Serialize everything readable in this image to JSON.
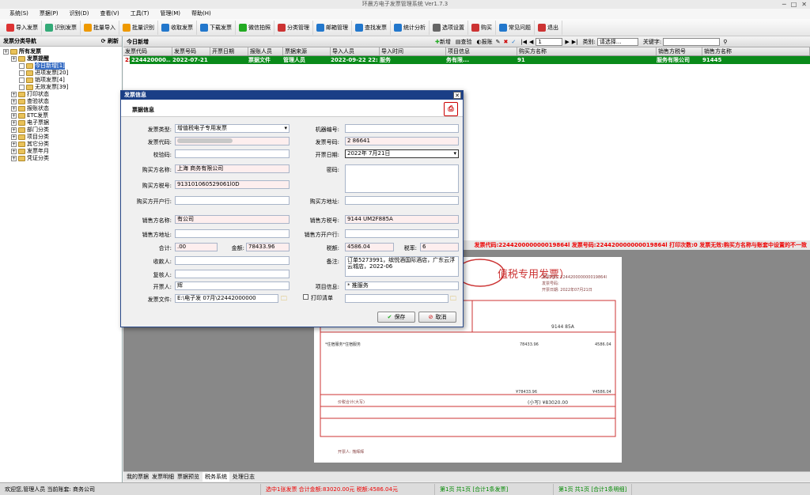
{
  "window": {
    "title": "环晨方电子发票管理系统 Ver1.7.3"
  },
  "menu": [
    "系统(S)",
    "票据(P)",
    "识别(D)",
    "查看(V)",
    "工具(T)",
    "管理(M)",
    "帮助(H)"
  ],
  "toolbar": [
    {
      "label": "导入发票",
      "icon": "import-icon",
      "color": "#d33"
    },
    {
      "label": "识别发票",
      "icon": "recognize-icon",
      "color": "#3a7"
    },
    {
      "label": "批量导入",
      "icon": "batch-import-icon",
      "color": "#e90"
    },
    {
      "label": "批量识别",
      "icon": "batch-recognize-icon",
      "color": "#e90"
    },
    {
      "label": "收取发票",
      "icon": "receive-icon",
      "color": "#27c"
    },
    {
      "label": "下载发票",
      "icon": "download-icon",
      "color": "#27c"
    },
    {
      "label": "微信拍照",
      "icon": "wechat-icon",
      "color": "#2a2"
    },
    {
      "label": "分类管理",
      "icon": "category-icon",
      "color": "#c33"
    },
    {
      "label": "邮箱管理",
      "icon": "mail-icon",
      "color": "#27c"
    },
    {
      "label": "查找发票",
      "icon": "find-icon",
      "color": "#27c"
    },
    {
      "label": "统计分析",
      "icon": "stats-icon",
      "color": "#27c"
    },
    {
      "label": "选项设置",
      "icon": "settings-icon",
      "color": "#666"
    },
    {
      "label": "购买",
      "icon": "buy-icon",
      "color": "#c33"
    },
    {
      "label": "常见问题",
      "icon": "faq-icon",
      "color": "#27c"
    },
    {
      "label": "退出",
      "icon": "exit-icon",
      "color": "#c33"
    }
  ],
  "nav": {
    "title": "发票分类导航",
    "refresh": "刷新",
    "items": [
      {
        "label": "所有发票",
        "level": 0,
        "bold": true
      },
      {
        "label": "发票提醒",
        "level": 1,
        "bold": true
      },
      {
        "label": "今日新增[1]",
        "level": 2,
        "selected": true
      },
      {
        "label": "进项发票[20]",
        "level": 2
      },
      {
        "label": "销项发票[4]",
        "level": 2
      },
      {
        "label": "无效发票[39]",
        "level": 2
      },
      {
        "label": "打印状态",
        "level": 1
      },
      {
        "label": "查验状态",
        "level": 1
      },
      {
        "label": "报账状态",
        "level": 1
      },
      {
        "label": "ETC发票",
        "level": 1
      },
      {
        "label": "电子票据",
        "level": 1
      },
      {
        "label": "部门分类",
        "level": 1
      },
      {
        "label": "项目分类",
        "level": 1
      },
      {
        "label": "其它分类",
        "level": 1
      },
      {
        "label": "发票年月",
        "level": 1
      },
      {
        "label": "凭证分类",
        "level": 1
      }
    ]
  },
  "main": {
    "title": "今日新增",
    "actions": [
      "新增",
      "查验",
      "报账"
    ],
    "page": "1",
    "category_label": "类别:",
    "category_value": "请选择...",
    "keyword_label": "关键字:",
    "columns": [
      "发票代码",
      "发票号码",
      "开票日期",
      "报账人员",
      "票据来源",
      "导入人员",
      "导入时间",
      "项目信息",
      "购买方名称",
      "销售方税号",
      "销售方名称"
    ],
    "row": [
      "224420000000...",
      "224420000...",
      "2022-07-21",
      "",
      "票据文件",
      "管理人员",
      "2022-09-22 22:28:36",
      "服务",
      "务有限...",
      "91",
      "服务有限公司",
      "91445"
    ]
  },
  "warning": "发票代码:224420000000019864l 发票号码:224420000000019864l 打印次数:0 发票无效:购买方名称与账套中设置的不一致",
  "dialog": {
    "title": "发票信息",
    "subtitle": "票据信息",
    "fields": {
      "invoice_type_label": "发票类型:",
      "invoice_type": "增值税电子专用发票",
      "machine_no_label": "机器编号:",
      "machine_no": "",
      "code_label": "发票代码:",
      "code": "",
      "number_label": "发票号码:",
      "number": "2       86641",
      "check_code_label": "校验码:",
      "check_code": "",
      "date_label": "开票日期:",
      "date": "2022年 7月21日",
      "buyer_name_label": "购买方名称:",
      "buyer_name": "上海          商务有限公司",
      "password_label": "密码:",
      "buyer_tax_label": "购买方税号:",
      "buyer_tax": "913101060529061l0D",
      "buyer_bank_label": "购买方开户行:",
      "buyer_addr_label": "购买方地址:",
      "seller_name_label": "销售方名称:",
      "seller_name": "         有公司",
      "seller_tax_label": "销售方税号:",
      "seller_tax": "9144      UM2F885A",
      "seller_addr_label": "销售方地址:",
      "seller_bank_label": "销售方开户行:",
      "total_label": "合计:",
      "total": ".00",
      "amount_label": "金额:",
      "amount": "78433.96",
      "tax_label": "税额:",
      "tax": "4586.04",
      "rate_label": "税率:",
      "rate": "6",
      "payee_label": "收款人:",
      "remark_label": "备注:",
      "remark": "订单5273991，缤悦酒国际酒店，广东云浮云城店，2022-06",
      "reviewer_label": "复核人:",
      "issuer_label": "开票人:",
      "issuer": "辉",
      "project_label": "项目信息:",
      "project": "*       推服务",
      "file_label": "发票文件:",
      "file": "E:\\电子发        07月\\22442000000",
      "print_list_label": "打印清单"
    },
    "save": "保存",
    "cancel": "取消"
  },
  "bottom_tabs": [
    "我的票据",
    "发票明细",
    "票据预览",
    "税务系统",
    "处理日志"
  ],
  "status": [
    {
      "text": "欢迎您,管理人员 当前账套:              商务公司",
      "color": "#000"
    },
    {
      "text": "选中1张发票 合计金额:83020.00元 税额:4586.04元",
      "color": "#e00"
    },
    {
      "text": "第1页 共1页 [合计1条发票]",
      "color": "#080"
    },
    {
      "text": "第1页 共1页 [合计1条明细]",
      "color": "#080"
    }
  ],
  "invoice_preview": {
    "heading": "值税专用发票）",
    "code_line": "发票代码: 224420000000019864l",
    "number_line": "发票号码:",
    "date_line": "开票日期: 2022年07月21日",
    "seller_tax": "9144              85A",
    "amount": "78433.96",
    "tax": "4586.04",
    "subtotal": "¥78433.96",
    "subtax": "¥4586.04",
    "item": "*住宿服务*住宿服务",
    "big_total_label": "价税合计(大写)",
    "small_total": "(小写) ¥83020.00",
    "issuer_line": "开票人: 熊辉辉"
  }
}
